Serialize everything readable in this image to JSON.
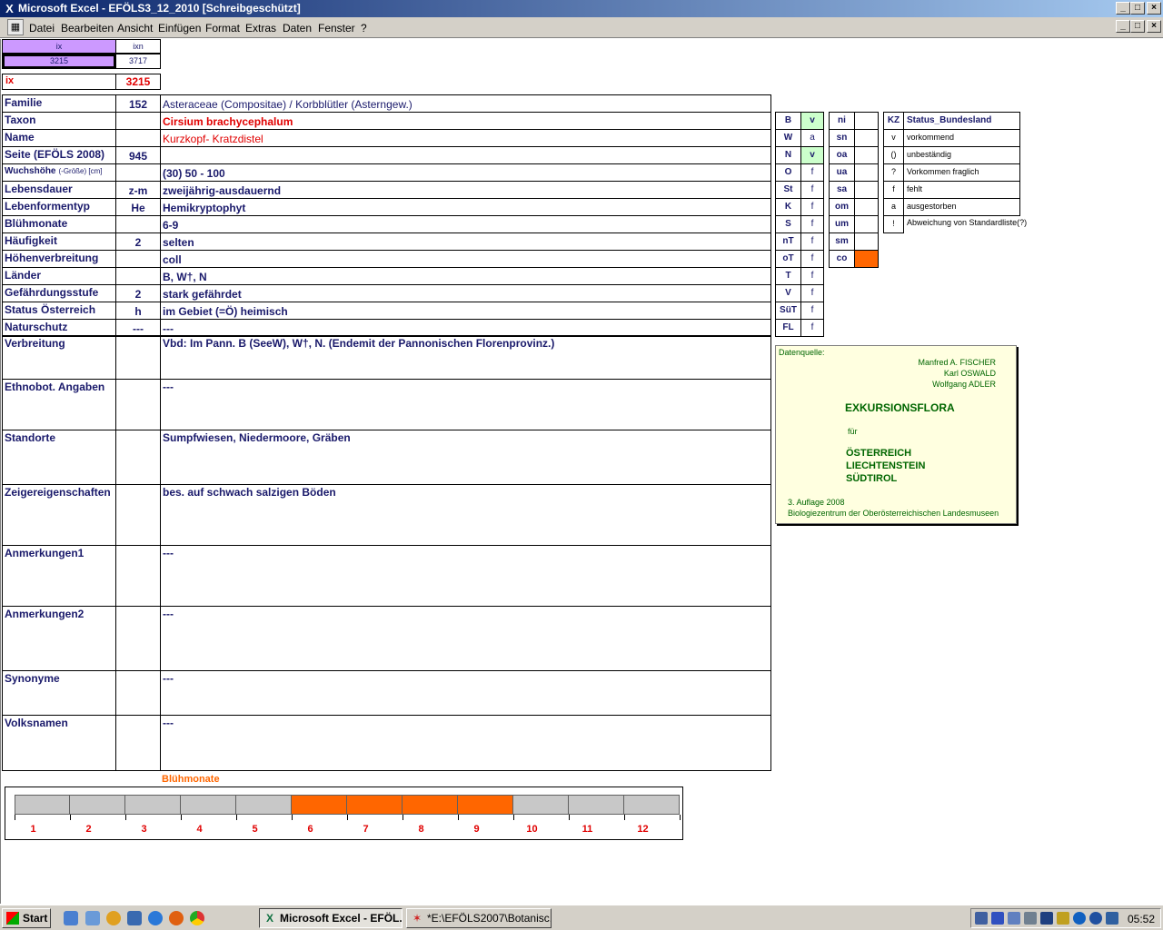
{
  "window": {
    "title": "Microsoft Excel - EFÖLS3_12_2010  [Schreibgeschützt]",
    "title_icon": "excel-icon"
  },
  "menu": [
    "Datei",
    "Bearbeiten",
    "Ansicht",
    "Einfügen",
    "Format",
    "Extras",
    "Daten",
    "Fenster",
    "?"
  ],
  "index": {
    "ix_header": "ix",
    "ixn_header": "ixn",
    "ix_value": "3215",
    "ixn_value": "3717",
    "ix_label": "ix",
    "ix_big": "3215"
  },
  "rows": [
    {
      "label": "Familie",
      "mid": "152",
      "value": "Asteraceae (Compositae)  /  Korbblütler (Asterngew.)",
      "style": "normal"
    },
    {
      "label": "Taxon",
      "mid": "",
      "value": "Cirsium brachycephalum",
      "style": "redbold"
    },
    {
      "label": "Name",
      "mid": "",
      "value": "Kurzkopf- Kratzdistel",
      "style": "red"
    },
    {
      "label": "Seite (EFÖLS 2008)",
      "mid": "945",
      "value": "",
      "style": "bold"
    },
    {
      "label": "Wuchshöhe",
      "label_suffix": "(-Größe) [cm]",
      "mid": "",
      "value": " (30) 50 - 100",
      "style": "bold"
    },
    {
      "label": "Lebensdauer",
      "mid": "z-m",
      "value": "zweijährig-ausdauernd",
      "style": "bold"
    },
    {
      "label": "Lebenformentyp",
      "mid": "He",
      "value": "Hemikryptophyt",
      "style": "bold"
    },
    {
      "label": "Blühmonate",
      "mid": "",
      "value": " 6-9",
      "style": "bold"
    },
    {
      "label": "Häufigkeit",
      "mid": "2",
      "value": "selten",
      "style": "bold"
    },
    {
      "label": "Höhenverbreitung",
      "mid": "",
      "value": "coll",
      "style": "bold"
    },
    {
      "label": "Länder",
      "mid": "",
      "value": " B, W†, N",
      "style": "bold"
    },
    {
      "label": "Gefährdungsstufe",
      "mid": "2",
      "value": "stark gefährdet",
      "style": "bold"
    },
    {
      "label": "Status Österreich",
      "mid": "h",
      "value": "im Gebiet (=Ö) heimisch",
      "style": "bold"
    },
    {
      "label": "Naturschutz",
      "mid": "---",
      "value": " ---",
      "style": "bold"
    }
  ],
  "tall_rows": [
    {
      "label": "Verbreitung",
      "value": "Vbd: Im Pann. B (SeeW), W†, N. (Endemit der Pannonischen Florenprovinz.)"
    },
    {
      "label": "Ethnobot. Angaben",
      "value": "---"
    },
    {
      "label": "Standorte",
      "value": "Sumpfwiesen, Niedermoore, Gräben"
    },
    {
      "label": "Zeigereigenschaften",
      "value": "bes. auf schwach salzigen Böden"
    },
    {
      "label": "Anmerkungen1",
      "value": "---"
    },
    {
      "label": "Anmerkungen2",
      "value": "---"
    },
    {
      "label": "Synonyme",
      "value": "---"
    },
    {
      "label": "Volksnamen",
      "value": "---"
    }
  ],
  "laender": [
    {
      "code": "B",
      "status": "v",
      "hl": true
    },
    {
      "code": "W",
      "status": "a",
      "hl": false
    },
    {
      "code": "N",
      "status": "v",
      "hl": true
    },
    {
      "code": "O",
      "status": "f",
      "hl": false
    },
    {
      "code": "St",
      "status": "f",
      "hl": false
    },
    {
      "code": "K",
      "status": "f",
      "hl": false
    },
    {
      "code": "S",
      "status": "f",
      "hl": false
    },
    {
      "code": "nT",
      "status": "f",
      "hl": false
    },
    {
      "code": "oT",
      "status": "f",
      "hl": false
    },
    {
      "code": "T",
      "status": "f",
      "hl": false
    },
    {
      "code": "V",
      "status": "f",
      "hl": false
    },
    {
      "code": "SüT",
      "status": "f",
      "hl": false
    },
    {
      "code": "FL",
      "status": "f",
      "hl": false
    }
  ],
  "hoehen": [
    {
      "code": "ni",
      "hl": false
    },
    {
      "code": "sn",
      "hl": false
    },
    {
      "code": "oa",
      "hl": false
    },
    {
      "code": "ua",
      "hl": false
    },
    {
      "code": "sa",
      "hl": false
    },
    {
      "code": "om",
      "hl": false
    },
    {
      "code": "um",
      "hl": false
    },
    {
      "code": "sm",
      "hl": false
    },
    {
      "code": "co",
      "hl": true
    }
  ],
  "legend": {
    "kz_header": "KZ",
    "status_header": "Status_Bundesland",
    "items": [
      {
        "kz": "v",
        "text": "vorkommend"
      },
      {
        "kz": "()",
        "text": "unbeständig"
      },
      {
        "kz": "?",
        "text": "Vorkommen fraglich"
      },
      {
        "kz": "f",
        "text": "fehlt"
      },
      {
        "kz": "a",
        "text": "ausgestorben"
      },
      {
        "kz": "!",
        "text": "Abweichung von Standardliste(?)"
      }
    ]
  },
  "source": {
    "label": "Datenquelle:",
    "authors": [
      "Manfred A. FISCHER",
      "Karl OSWALD",
      "Wolfgang ADLER"
    ],
    "title": "EXKURSIONSFLORA",
    "fuer": "für",
    "countries": [
      "ÖSTERREICH",
      "LIECHTENSTEIN",
      "SÜDTIROL"
    ],
    "edition": "3. Auflage 2008",
    "publisher": "Biologiezentrum der Oberösterreichischen Landesmuseen"
  },
  "bloom": {
    "title": "Blühmonate",
    "months": [
      "1",
      "2",
      "3",
      "4",
      "5",
      "6",
      "7",
      "8",
      "9",
      "10",
      "11",
      "12"
    ],
    "active": [
      6,
      7,
      8,
      9
    ],
    "active_color": "#ff6600",
    "inactive_color": "#c8c8c8"
  },
  "taskbar": {
    "start": "Start",
    "tasks": [
      {
        "label": "Microsoft Excel - EFÖL...",
        "active": true,
        "icon": "excel-icon"
      },
      {
        "label": "*E:\\EFÖLS2007\\Botanisc...",
        "active": false,
        "icon": "notepad-icon"
      }
    ],
    "clock": "05:52"
  },
  "colors": {
    "label_blue": "#1a1a6b",
    "red": "#e00000",
    "green_cell": "#ccffcc",
    "orange": "#ff6600",
    "source_bg": "#ffffe0",
    "source_green": "#006600",
    "index_purple": "#cc99ff"
  }
}
